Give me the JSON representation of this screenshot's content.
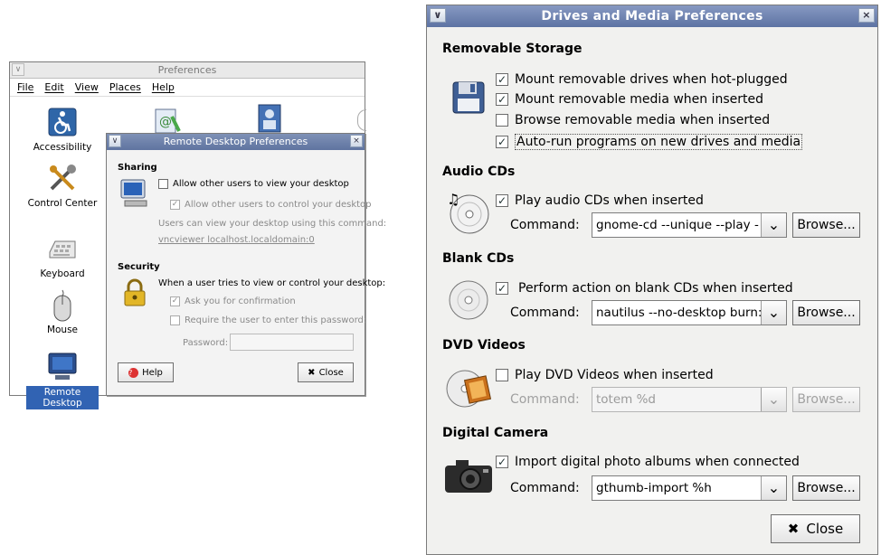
{
  "preferences": {
    "title": "Preferences",
    "menu": [
      "File",
      "Edit",
      "View",
      "Places",
      "Help"
    ],
    "items": [
      {
        "label": "Accessibility",
        "icon": "accessibility-icon"
      },
      {
        "label": "Control Center",
        "icon": "tools-icon"
      },
      {
        "label": "Keyboard",
        "icon": "keyboard-icon"
      },
      {
        "label": "Mouse",
        "icon": "mouse-icon"
      },
      {
        "label": "Remote Desktop",
        "icon": "remote-desktop-icon",
        "selected": true
      }
    ]
  },
  "remote_desktop": {
    "title": "Remote Desktop Preferences",
    "sharing_heading": "Sharing",
    "allow_view": {
      "label": "Allow other users to view your desktop",
      "checked": false
    },
    "allow_control": {
      "label": "Allow other users to control your desktop",
      "checked": true
    },
    "view_hint": "Users can view your desktop using this command:",
    "view_command": "vncviewer localhost.localdomain:0",
    "security_heading": "Security",
    "security_intro": "When a user tries to view or control your desktop:",
    "ask_confirm": {
      "label": "Ask you for confirmation",
      "checked": true
    },
    "require_password": {
      "label": "Require the user to enter this password:",
      "checked": false
    },
    "password_label": "Password:",
    "help_button": "Help",
    "close_button": "Close"
  },
  "drives": {
    "title": "Drives and Media Preferences",
    "removable": {
      "heading": "Removable Storage",
      "options": [
        {
          "label": "Mount removable drives when hot-plugged",
          "checked": true
        },
        {
          "label": "Mount removable media when inserted",
          "checked": true
        },
        {
          "label": "Browse removable media when inserted",
          "checked": false
        },
        {
          "label": "Auto-run programs on new drives and media",
          "checked": true
        }
      ]
    },
    "audio": {
      "heading": "Audio CDs",
      "option": {
        "label": "Play audio CDs when inserted",
        "checked": true
      },
      "command_label": "Command:",
      "command": "gnome-cd --unique --play -",
      "browse": "Browse..."
    },
    "blank": {
      "heading": "Blank CDs",
      "option": {
        "label": "Perform action on blank CDs when inserted",
        "checked": true
      },
      "command_label": "Command:",
      "command": "nautilus --no-desktop burn:",
      "browse": "Browse..."
    },
    "dvd": {
      "heading": "DVD Videos",
      "option": {
        "label": "Play DVD Videos when inserted",
        "checked": false
      },
      "command_label": "Command:",
      "command": "totem %d",
      "browse": "Browse..."
    },
    "camera": {
      "heading": "Digital Camera",
      "option": {
        "label": "Import digital photo albums when connected",
        "checked": true
      },
      "command_label": "Command:",
      "command": "gthumb-import %h",
      "browse": "Browse..."
    },
    "close_button": "Close"
  }
}
